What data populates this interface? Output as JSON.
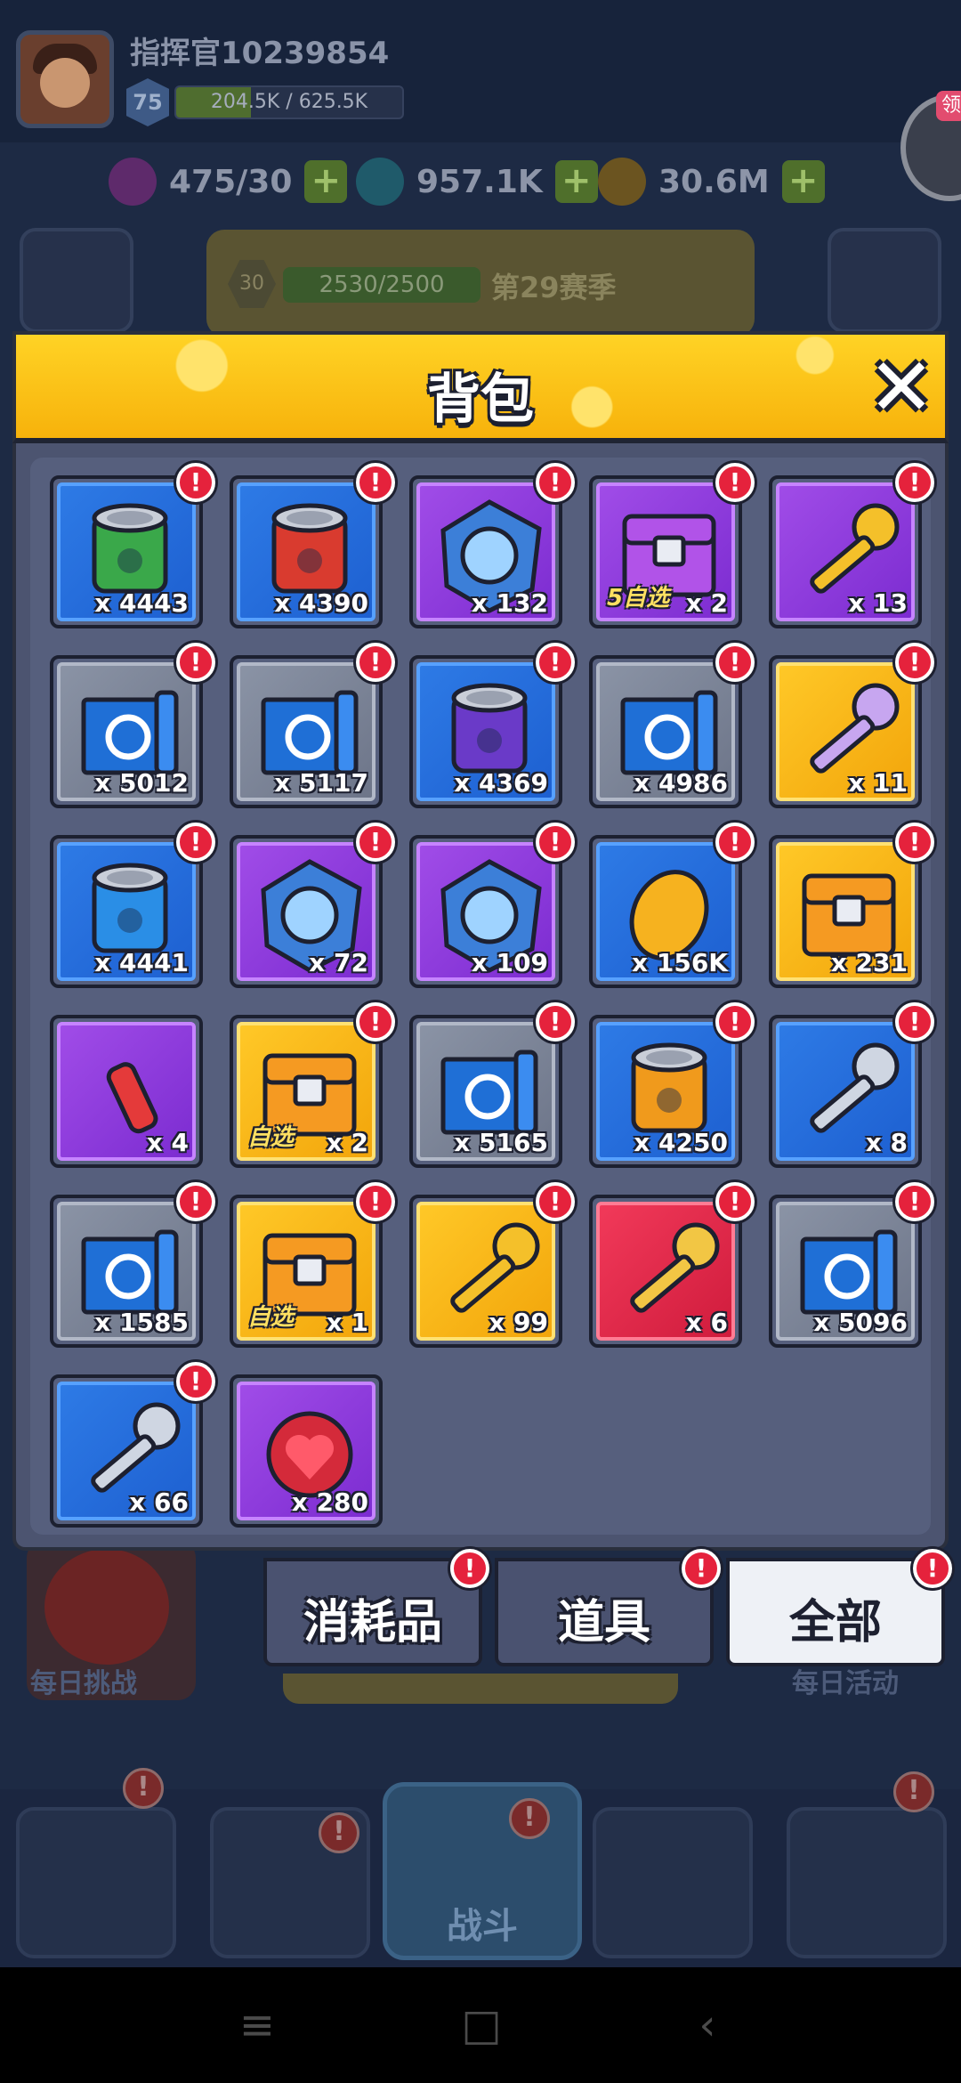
{
  "player": {
    "name": "指挥官10239854",
    "level": "75",
    "exp_text": "204.5K / 625.5K",
    "exp_fraction": 0.33
  },
  "resources": {
    "energy": "475/30",
    "gems": "957.1K",
    "coins": "30.6M"
  },
  "season": {
    "level": "30",
    "progress": "2530/2500",
    "label": "第29赛季"
  },
  "side_gift_tag": "领",
  "background_labels": {
    "daily_challenge": "每日挑战",
    "daily_event": "每日活动",
    "battle": "战斗"
  },
  "backpack": {
    "title": "背包",
    "close_icon": "close-x-icon",
    "alert_mark": "!",
    "select_tag": "自选",
    "select_tag_5": "5自选",
    "items": [
      {
        "icon": "green-leaf-can-icon",
        "rarity": "blue",
        "qty": "x 4443",
        "alert": true
      },
      {
        "icon": "red-fire-can-icon",
        "rarity": "blue",
        "qty": "x 4390",
        "alert": true
      },
      {
        "icon": "hero-shard-green-icon",
        "rarity": "purple",
        "qty": "x 132",
        "alert": true
      },
      {
        "icon": "purple-chest-5-select-icon",
        "rarity": "purple",
        "qty": "x 2",
        "alert": true,
        "tag": "5自选"
      },
      {
        "icon": "gold-key-icon",
        "rarity": "purple",
        "qty": "x 13",
        "alert": true
      },
      {
        "icon": "blueprint-ring-icon",
        "rarity": "gray",
        "qty": "x 5012",
        "alert": true
      },
      {
        "icon": "blueprint-helmet-icon",
        "rarity": "gray",
        "qty": "x 5117",
        "alert": true
      },
      {
        "icon": "purple-moon-can-icon",
        "rarity": "blue",
        "qty": "x 4369",
        "alert": true
      },
      {
        "icon": "blueprint-glove-icon",
        "rarity": "gray",
        "qty": "x 4986",
        "alert": true
      },
      {
        "icon": "purple-key-icon",
        "rarity": "yellow",
        "qty": "x 11",
        "alert": true
      },
      {
        "icon": "blue-water-can-icon",
        "rarity": "blue",
        "qty": "x 4441",
        "alert": true
      },
      {
        "icon": "hero-shard-ghost-icon",
        "rarity": "purple",
        "qty": "x 72",
        "alert": true
      },
      {
        "icon": "hero-shard-raccoon-icon",
        "rarity": "purple",
        "qty": "x 109",
        "alert": true
      },
      {
        "icon": "gold-ingot-icon",
        "rarity": "blue",
        "qty": "x 156K",
        "alert": true
      },
      {
        "icon": "orange-chest-icon",
        "rarity": "yellow",
        "qty": "x 231",
        "alert": true
      },
      {
        "icon": "soda-bottle-icon",
        "rarity": "purple",
        "qty": "x 4",
        "alert": false
      },
      {
        "icon": "cat-chest-select-icon",
        "rarity": "yellow",
        "qty": "x 2",
        "alert": true,
        "tag": "自选"
      },
      {
        "icon": "blueprint-armor-icon",
        "rarity": "gray",
        "qty": "x 5165",
        "alert": true
      },
      {
        "icon": "orange-star-can-icon",
        "rarity": "blue",
        "qty": "x 4250",
        "alert": true
      },
      {
        "icon": "silver-key-icon",
        "rarity": "blue",
        "qty": "x 8",
        "alert": true
      },
      {
        "icon": "blueprint-gun-icon",
        "rarity": "gray",
        "qty": "x 1585",
        "alert": true
      },
      {
        "icon": "hex-chest-select-icon",
        "rarity": "yellow",
        "qty": "x 1",
        "alert": true,
        "tag": "自选"
      },
      {
        "icon": "gold-purple-key-icon",
        "rarity": "yellow",
        "qty": "x 99",
        "alert": true
      },
      {
        "icon": "magic-star-key-icon",
        "rarity": "red",
        "qty": "x 6",
        "alert": true
      },
      {
        "icon": "blueprint-boot-icon",
        "rarity": "gray",
        "qty": "x 5096",
        "alert": true
      },
      {
        "icon": "silver-ring-key-icon",
        "rarity": "blue",
        "qty": "x 66",
        "alert": true
      },
      {
        "icon": "heart-token-icon",
        "rarity": "purple",
        "qty": "x 280",
        "alert": false
      }
    ]
  },
  "tabs": [
    {
      "label": "消耗品",
      "active": false,
      "alert": true
    },
    {
      "label": "道具",
      "active": false,
      "alert": true
    },
    {
      "label": "全部",
      "active": true,
      "alert": true
    }
  ],
  "colors": {
    "header_yellow": "#ffd325",
    "rarity_blue": "#2e7be6",
    "rarity_purple": "#a14de8",
    "rarity_gray": "#8b94a6",
    "rarity_yellow": "#ffc928",
    "rarity_red": "#f23a5a",
    "alert_red": "#e5223c"
  },
  "system_nav": {
    "menu_icon": "menu-lines-icon",
    "home_icon": "home-square-icon",
    "back_icon": "back-chevron-icon"
  }
}
